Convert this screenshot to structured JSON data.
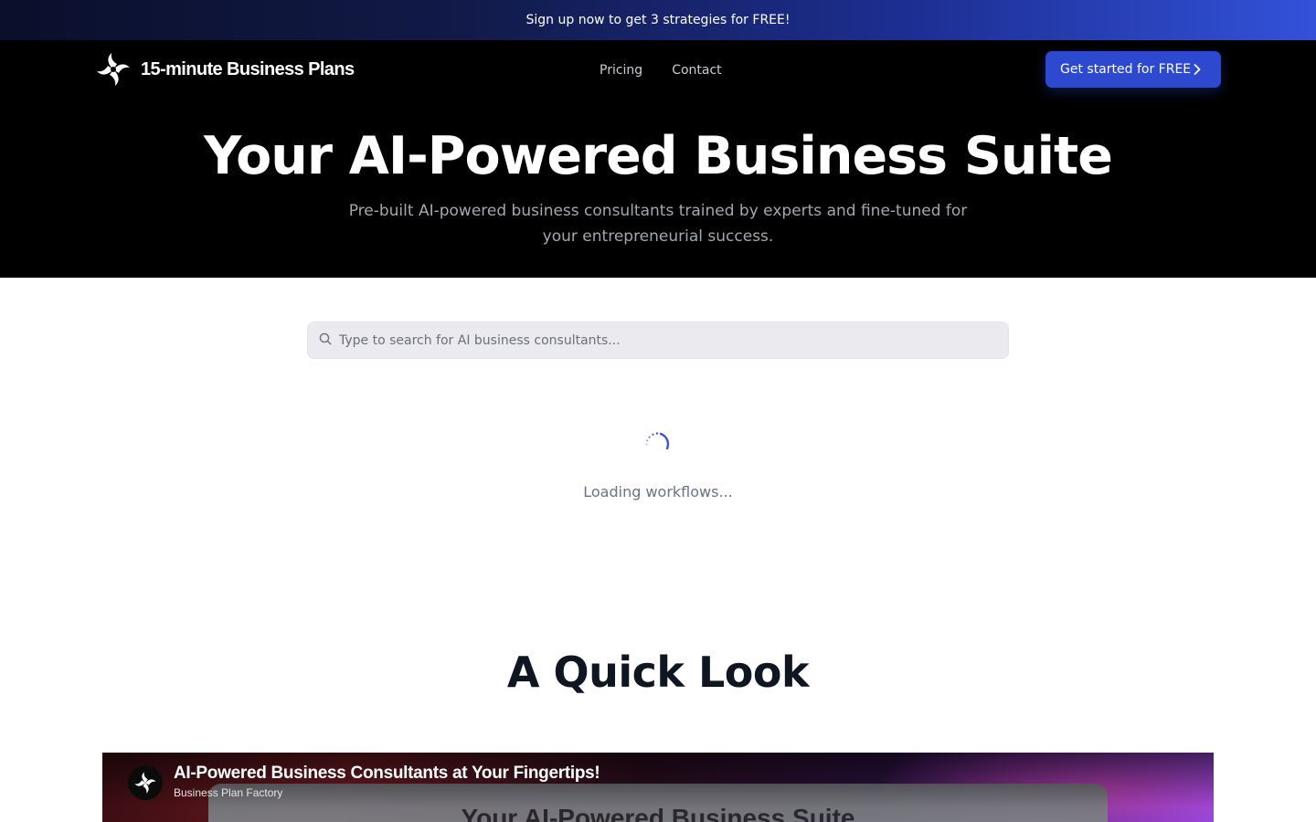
{
  "announcement": {
    "text": "Sign up now to get 3 strategies for FREE!"
  },
  "header": {
    "brand": "15-minute Business Plans",
    "nav": [
      {
        "label": "Pricing"
      },
      {
        "label": "Contact"
      }
    ],
    "cta_label": "Get started for FREE"
  },
  "hero": {
    "title": "Your AI-Powered Business Suite",
    "subtitle": "Pre-built AI-powered business consultants trained by experts and fine-tuned for your entrepreneurial success."
  },
  "search": {
    "placeholder": "Type to search for AI business consultants...",
    "value": ""
  },
  "loading": {
    "text": "Loading workflows..."
  },
  "quick_look": {
    "title": "A Quick Look",
    "video": {
      "title": "AI-Powered Business Consultants at Your Fingertips!",
      "channel": "Business Plan Factory",
      "screen_text": "Your AI-Powered Business Suite"
    }
  },
  "colors": {
    "accent": "#2c49d0",
    "hero_bg": "#000000",
    "search_bg": "#ebebef"
  },
  "icons": {
    "logo": "pinwheel-logo-icon",
    "cta": "chevron-right-icon",
    "search": "search-icon",
    "loading": "spinner-icon"
  }
}
